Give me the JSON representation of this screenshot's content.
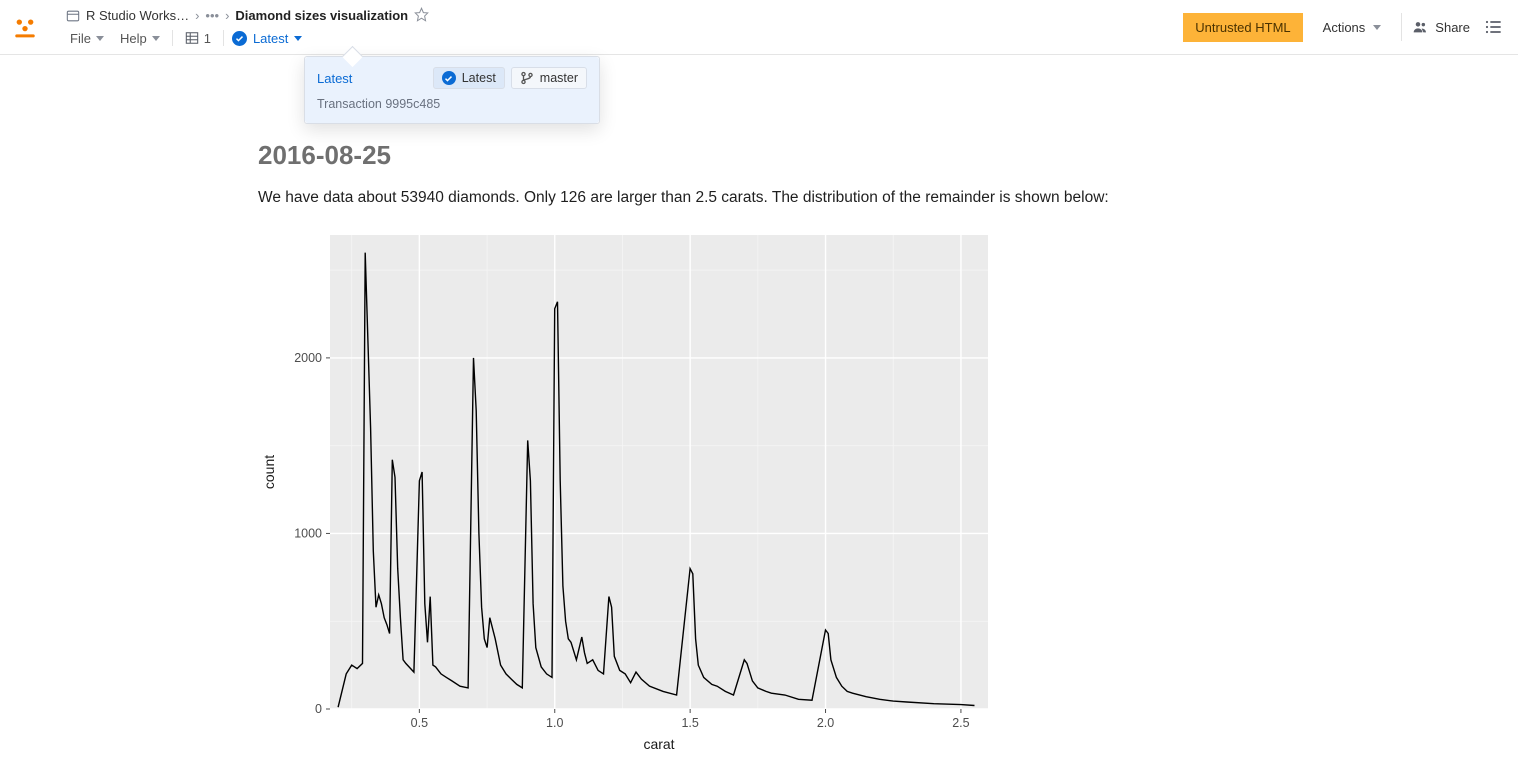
{
  "breadcrumb": {
    "workspace": "R Studio Works…",
    "title": "Diamond sizes visualization"
  },
  "menubar": {
    "file": "File",
    "help": "Help",
    "count": "1",
    "latest": "Latest"
  },
  "topright": {
    "untrusted": "Untrusted HTML",
    "actions": "Actions",
    "share": "Share"
  },
  "popover": {
    "title": "Latest",
    "latest_pill": "Latest",
    "master_pill": "master",
    "sub": "Transaction 9995c485"
  },
  "page": {
    "date": "2016-08-25",
    "text": "We have data about 53940 diamonds. Only 126 are larger than 2.5 carats. The distribution of the remainder is shown below:"
  },
  "chart_data": {
    "type": "line",
    "xlabel": "carat",
    "ylabel": "count",
    "x_ticks": [
      0.5,
      1.0,
      1.5,
      2.0,
      2.5
    ],
    "y_ticks": [
      0,
      1000,
      2000
    ],
    "xlim": [
      0.17,
      2.6
    ],
    "ylim": [
      0,
      2700
    ],
    "x": [
      0.2,
      0.23,
      0.25,
      0.27,
      0.29,
      0.3,
      0.31,
      0.32,
      0.33,
      0.34,
      0.35,
      0.36,
      0.37,
      0.38,
      0.39,
      0.4,
      0.41,
      0.42,
      0.43,
      0.44,
      0.45,
      0.48,
      0.5,
      0.51,
      0.52,
      0.53,
      0.54,
      0.55,
      0.56,
      0.58,
      0.6,
      0.62,
      0.65,
      0.68,
      0.7,
      0.71,
      0.72,
      0.73,
      0.74,
      0.75,
      0.76,
      0.78,
      0.8,
      0.82,
      0.84,
      0.86,
      0.88,
      0.9,
      0.91,
      0.92,
      0.93,
      0.95,
      0.97,
      0.99,
      1.0,
      1.01,
      1.02,
      1.03,
      1.04,
      1.05,
      1.06,
      1.08,
      1.1,
      1.11,
      1.12,
      1.14,
      1.16,
      1.18,
      1.2,
      1.21,
      1.22,
      1.24,
      1.26,
      1.28,
      1.3,
      1.32,
      1.35,
      1.4,
      1.45,
      1.5,
      1.51,
      1.52,
      1.53,
      1.55,
      1.58,
      1.6,
      1.63,
      1.66,
      1.7,
      1.71,
      1.73,
      1.75,
      1.78,
      1.8,
      1.85,
      1.9,
      1.95,
      2.0,
      2.01,
      2.02,
      2.04,
      2.06,
      2.08,
      2.1,
      2.15,
      2.2,
      2.25,
      2.3,
      2.4,
      2.5,
      2.55
    ],
    "values": [
      10,
      200,
      250,
      230,
      260,
      2600,
      2100,
      1600,
      900,
      580,
      650,
      600,
      520,
      480,
      430,
      1420,
      1320,
      800,
      520,
      280,
      260,
      210,
      1300,
      1350,
      600,
      380,
      640,
      250,
      240,
      200,
      180,
      160,
      130,
      120,
      2000,
      1700,
      1000,
      580,
      400,
      350,
      520,
      400,
      250,
      200,
      170,
      140,
      120,
      1530,
      1300,
      600,
      350,
      240,
      200,
      180,
      2280,
      2320,
      1300,
      700,
      500,
      400,
      380,
      280,
      410,
      320,
      260,
      280,
      220,
      200,
      640,
      580,
      300,
      220,
      200,
      150,
      210,
      170,
      130,
      100,
      80,
      800,
      770,
      400,
      250,
      180,
      140,
      130,
      100,
      80,
      280,
      260,
      160,
      120,
      100,
      90,
      80,
      55,
      50,
      450,
      430,
      280,
      180,
      130,
      100,
      90,
      70,
      55,
      45,
      40,
      30,
      25,
      20
    ]
  }
}
